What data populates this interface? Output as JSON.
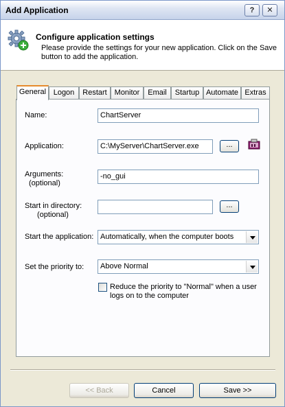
{
  "window": {
    "title": "Add Application",
    "help_label": "?",
    "close_label": "✕"
  },
  "header": {
    "title": "Configure application settings",
    "description": "Please provide the settings for your new application. Click on the Save button to add the application.",
    "icon": "gear-add-icon"
  },
  "tabs": [
    {
      "label": "General",
      "active": true
    },
    {
      "label": "Logon"
    },
    {
      "label": "Restart"
    },
    {
      "label": "Monitor"
    },
    {
      "label": "Email"
    },
    {
      "label": "Startup"
    },
    {
      "label": "Automate"
    },
    {
      "label": "Extras"
    }
  ],
  "form": {
    "name_label": "Name:",
    "name_value": "ChartServer",
    "application_label": "Application:",
    "application_value": "C:\\MyServer\\ChartServer.exe",
    "browse_label": "...",
    "arguments_label": "Arguments:",
    "arguments_optional": "(optional)",
    "arguments_value": "-no_gui",
    "startdir_label": "Start in directory:",
    "startdir_optional": "(optional)",
    "startdir_value": "",
    "start_label": "Start the application:",
    "start_value": "Automatically, when the computer boots",
    "priority_label": "Set the priority to:",
    "priority_value": "Above Normal",
    "reduce_label": "Reduce the priority to \"Normal\" when a user logs on to the computer",
    "reduce_checked": false
  },
  "buttons": {
    "back": "<< Back",
    "cancel": "Cancel",
    "save": "Save >>"
  }
}
